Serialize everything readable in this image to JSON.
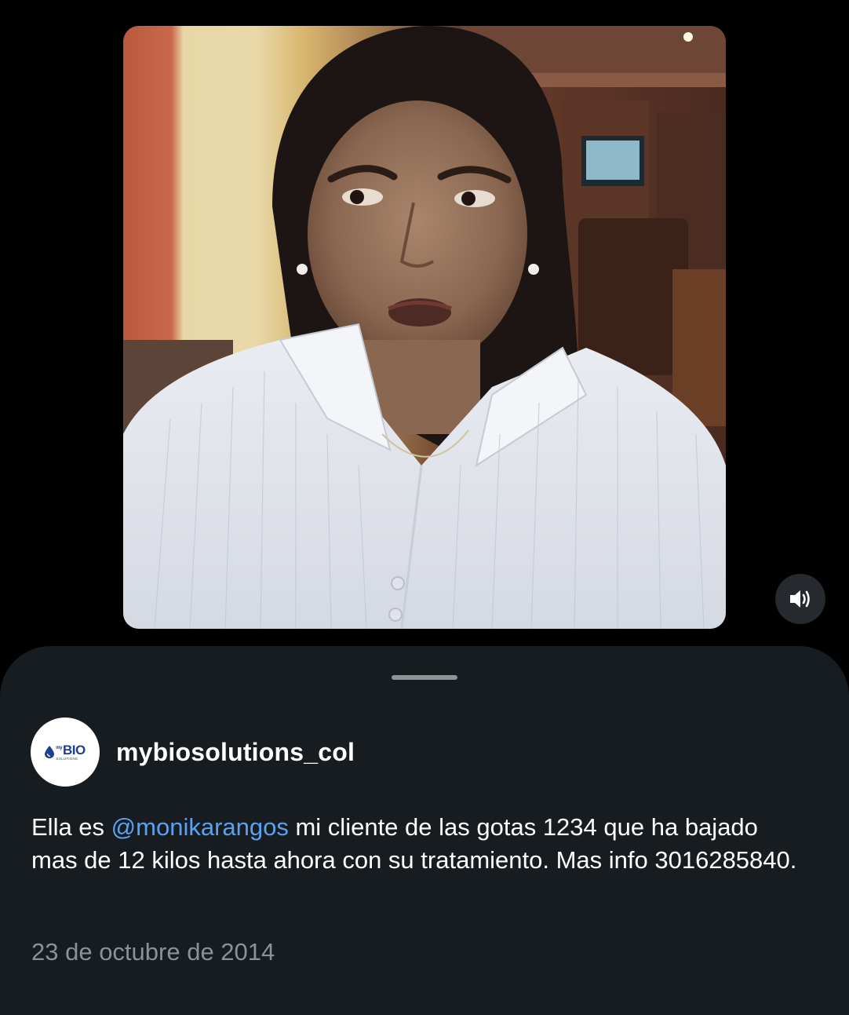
{
  "author": {
    "username": "mybiosolutions_col",
    "avatar_logo": {
      "main": "BIO",
      "prefix": "my",
      "sub": "SOLUTIONS"
    }
  },
  "caption": {
    "before_mention": "Ella es ",
    "mention": "@monikarangos",
    "after_mention": " mi cliente de las gotas 1234 que ha bajado mas de 12 kilos hasta ahora con su tratamiento. Mas info 3016285840."
  },
  "post_date": "23 de octubre de 2014",
  "icons": {
    "mute": "speaker-volume-icon",
    "logo_drop": "drop-icon"
  },
  "colors": {
    "background": "#000000",
    "sheet": "#171c20",
    "mention": "#5aa1f0",
    "date": "#8b9196"
  }
}
